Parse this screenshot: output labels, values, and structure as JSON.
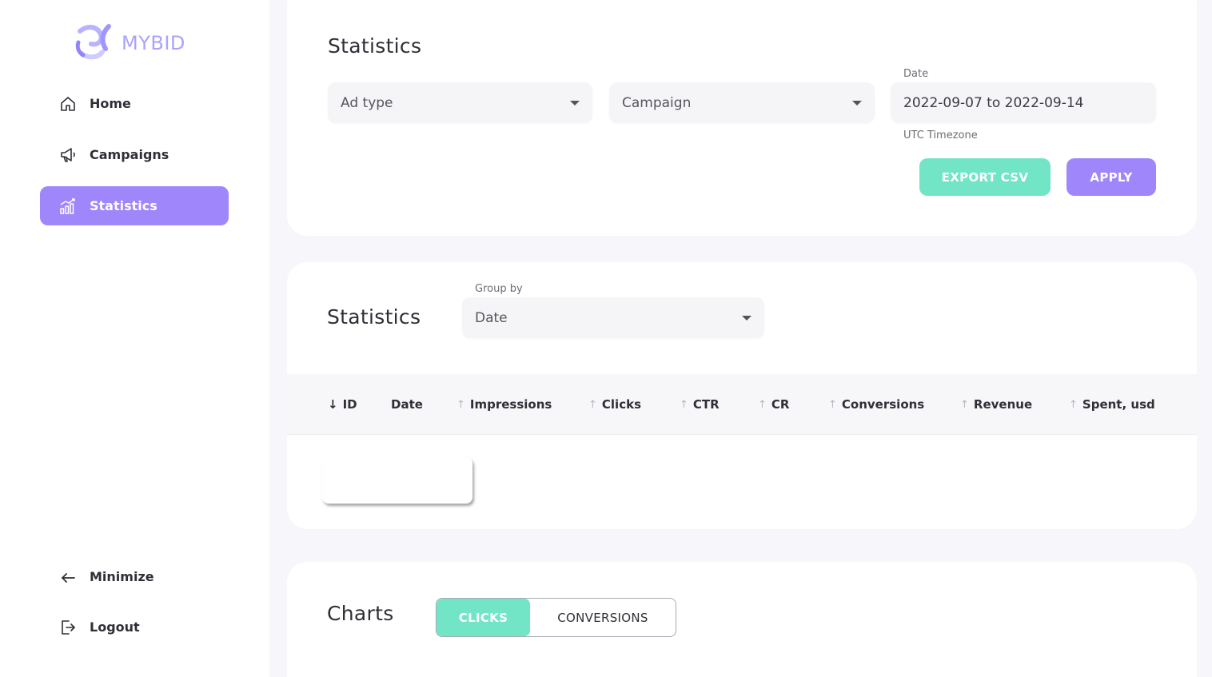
{
  "brand": {
    "name": "MYBID",
    "color": "#a9a3ff"
  },
  "sidebar": {
    "items": [
      {
        "label": "Home",
        "icon": "home-icon"
      },
      {
        "label": "Campaigns",
        "icon": "megaphone-icon"
      },
      {
        "label": "Statistics",
        "icon": "chart-icon",
        "active": true
      }
    ],
    "minimize_label": "Minimize",
    "logout_label": "Logout"
  },
  "filters": {
    "title": "Statistics",
    "ad_type_placeholder": "Ad type",
    "campaign_placeholder": "Campaign",
    "date_label": "Date",
    "date_value": "2022-09-07 to 2022-09-14",
    "timezone_label": "UTC Timezone",
    "export_label": "EXPORT CSV",
    "apply_label": "APPLY"
  },
  "table": {
    "title": "Statistics",
    "group_by_label": "Group by",
    "group_by_value": "Date",
    "columns": [
      "ID",
      "Date",
      "Impressions",
      "Clicks",
      "CTR",
      "CR",
      "Conversions",
      "Revenue",
      "Spent, usd"
    ]
  },
  "charts": {
    "title": "Charts",
    "options": [
      "CLICKS",
      "CONVERSIONS"
    ],
    "active_option": "CLICKS"
  },
  "colors": {
    "accent_purple": "#a086fb",
    "accent_teal": "#72e5c7",
    "background": "#f7f7fb"
  }
}
